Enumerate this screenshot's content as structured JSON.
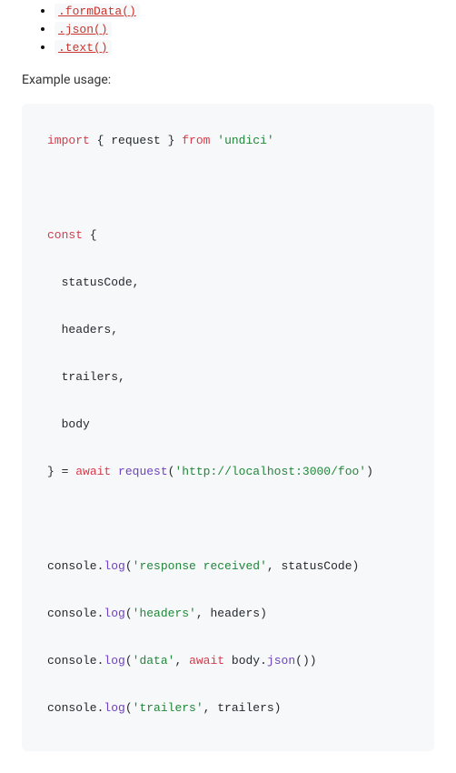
{
  "api_links": {
    "items": [
      {
        "label": ".formData()"
      },
      {
        "label": ".json()"
      },
      {
        "label": ".text()"
      }
    ]
  },
  "example_heading": "Example usage:",
  "chart_data": {
    "type": "table",
    "title": "Example usage code",
    "code_lines": [
      "import { request } from 'undici'",
      "",
      "const {",
      "  statusCode,",
      "  headers,",
      "  trailers,",
      "  body",
      "} = await request('http://localhost:3000/foo')",
      "",
      "console.log('response received', statusCode)",
      "console.log('headers', headers)",
      "console.log('data', await body.json())",
      "console.log('trailers', trailers)"
    ]
  },
  "code": {
    "kw_import": "import",
    "open_brace": " { ",
    "ident_request": "request",
    "close_brace": " } ",
    "kw_from": "from",
    "sp": " ",
    "str_undici": "'undici'",
    "kw_const": "const",
    "brace_only": " {",
    "item_status": "  statusCode,",
    "item_headers": "  headers,",
    "item_trailers": "  trailers,",
    "item_body": "  body",
    "close_obj": "} = ",
    "kw_await": "await",
    "fn_request": "request",
    "lp": "(",
    "str_url": "'http://localhost:3000/foo'",
    "rp": ")",
    "console": "console",
    "dot": ".",
    "fn_log": "log",
    "str_resp": "'response received'",
    "comma_status": ", statusCode)",
    "str_headers": "'headers'",
    "comma_headers": ", headers)",
    "str_data": "'data'",
    "comma_sp": ", ",
    "await_sp": " ",
    "body_ident": "body",
    "fn_json": "json",
    "empty_call": "())",
    "str_trailers": "'trailers'",
    "comma_trailers": ", trailers)"
  }
}
